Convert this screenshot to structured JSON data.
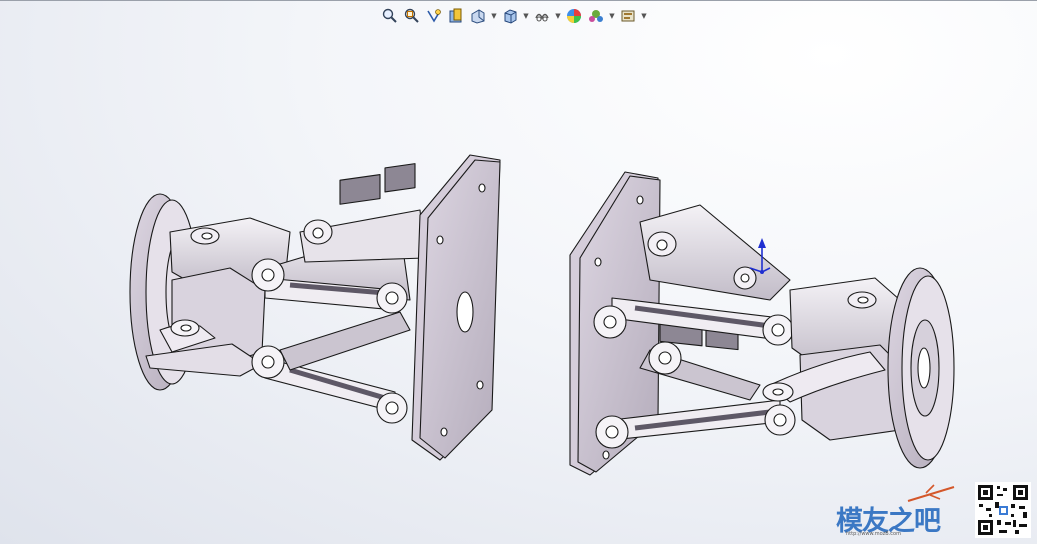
{
  "toolbar": {
    "items": [
      {
        "icon": "zoom-to-fit-icon",
        "dropdown": false
      },
      {
        "icon": "zoom-to-area-icon",
        "dropdown": false
      },
      {
        "icon": "previous-view-icon",
        "dropdown": false
      },
      {
        "icon": "section-view-icon",
        "dropdown": false
      },
      {
        "icon": "dynamic-annotation-views-icon",
        "dropdown": true
      },
      {
        "icon": "view-orientation-icon",
        "dropdown": true
      },
      {
        "icon": "display-style-icon",
        "dropdown": true
      },
      {
        "icon": "edit-appearance-icon",
        "dropdown": false
      },
      {
        "icon": "apply-scene-icon",
        "dropdown": true
      },
      {
        "icon": "view-settings-icon",
        "dropdown": true
      }
    ]
  },
  "watermark": {
    "text": "模友之吧",
    "url": "http://www.mozB.com"
  },
  "colors": {
    "part_face": "#c9c2cf",
    "part_edge": "#1a1a1a",
    "triad_axis": "#1f2fd1"
  }
}
